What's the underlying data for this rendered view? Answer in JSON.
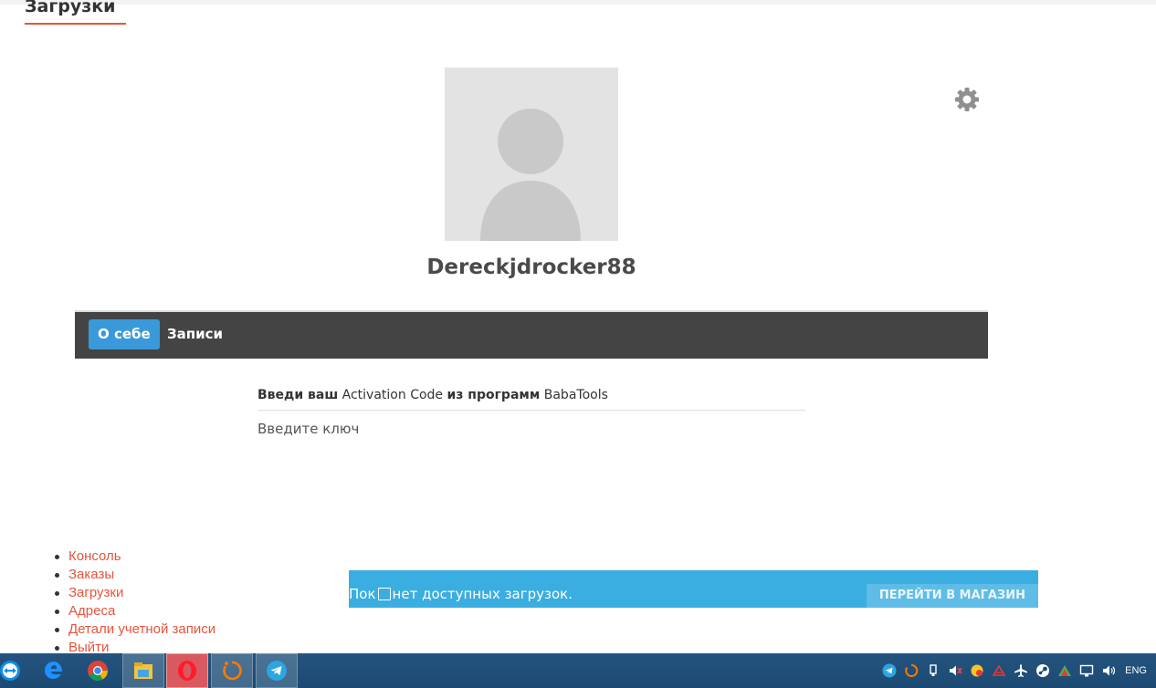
{
  "page": {
    "heading": "Загрузки"
  },
  "profile": {
    "username": "Dereckjdrocker88"
  },
  "tabs": [
    {
      "label": "О себе",
      "active": true
    },
    {
      "label": "Записи",
      "active": false
    }
  ],
  "activation": {
    "label_bold_1": "Введи ваш",
    "label_normal_1": " Activation Code ",
    "label_bold_2": "из программ",
    "label_normal_2": " BabaTools",
    "placeholder": "Введите ключ"
  },
  "account_nav": [
    {
      "label": "Консоль"
    },
    {
      "label": "Заказы"
    },
    {
      "label": "Загрузки"
    },
    {
      "label": "Адреса"
    },
    {
      "label": "Детали учетной записи"
    },
    {
      "label": "Выйти"
    }
  ],
  "notice": {
    "text_before": "Пок",
    "text_after": "нет доступных загрузок.",
    "button_label": "ПЕРЕЙТИ В МАГАЗИН"
  },
  "taskbar": {
    "apps": [
      "teamviewer-icon",
      "edge-icon",
      "chrome-icon",
      "file-explorer-icon",
      "opera-icon",
      "avast-icon",
      "telegram-icon"
    ],
    "tray_icons": [
      "telegram-tray-icon",
      "avast-tray-icon",
      "usb-icon",
      "volume-muted-icon",
      "security-icon",
      "network-alert-icon",
      "airplane-icon",
      "steam-icon",
      "tray-app-icon",
      "display-icon",
      "volume-icon"
    ],
    "language": "ENG"
  },
  "colors": {
    "accent": "#e5553b",
    "tab_active": "#3a9ad9",
    "tab_bar": "#444444",
    "notice": "#3aaee0",
    "taskbar": "#1c4a73"
  }
}
